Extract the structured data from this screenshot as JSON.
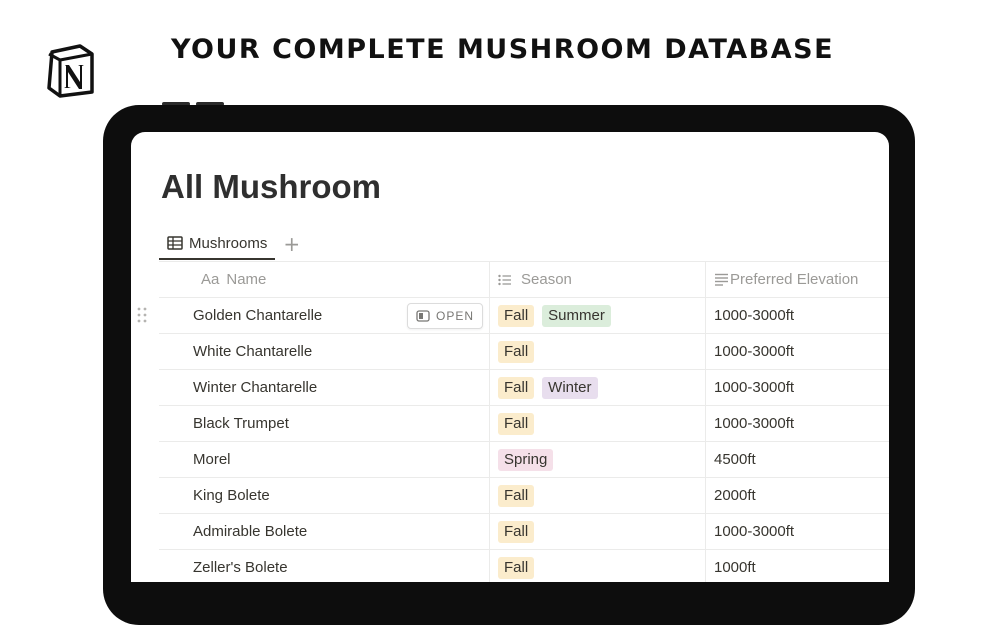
{
  "banner": {
    "headline": "YOUR COMPLETE MUSHROOM DATABASE",
    "logo_icon": "notion-logo-icon"
  },
  "page": {
    "title": "All Mushroom",
    "tab_label": "Mushrooms",
    "add_view": "+"
  },
  "columns": {
    "name": "Name",
    "name_icon": "Aa",
    "season": "Season",
    "elevation": "Preferred Elevation"
  },
  "open_label": "OPEN",
  "tag_colors": {
    "Fall": "#fbeccc",
    "Summer": "#dbeddb",
    "Winter": "#e8deee",
    "Spring": "#f5e0e9"
  },
  "rows": [
    {
      "name": "Golden Chantarelle",
      "season": [
        "Fall",
        "Summer"
      ],
      "elevation": "1000-3000ft"
    },
    {
      "name": "White Chantarelle",
      "season": [
        "Fall"
      ],
      "elevation": "1000-3000ft"
    },
    {
      "name": "Winter Chantarelle",
      "season": [
        "Fall",
        "Winter"
      ],
      "elevation": "1000-3000ft"
    },
    {
      "name": "Black Trumpet",
      "season": [
        "Fall"
      ],
      "elevation": "1000-3000ft"
    },
    {
      "name": "Morel",
      "season": [
        "Spring"
      ],
      "elevation": "4500ft"
    },
    {
      "name": "King Bolete",
      "season": [
        "Fall"
      ],
      "elevation": "2000ft"
    },
    {
      "name": "Admirable Bolete",
      "season": [
        "Fall"
      ],
      "elevation": "1000-3000ft"
    },
    {
      "name": "Zeller's Bolete",
      "season": [
        "Fall"
      ],
      "elevation": "1000ft"
    }
  ]
}
